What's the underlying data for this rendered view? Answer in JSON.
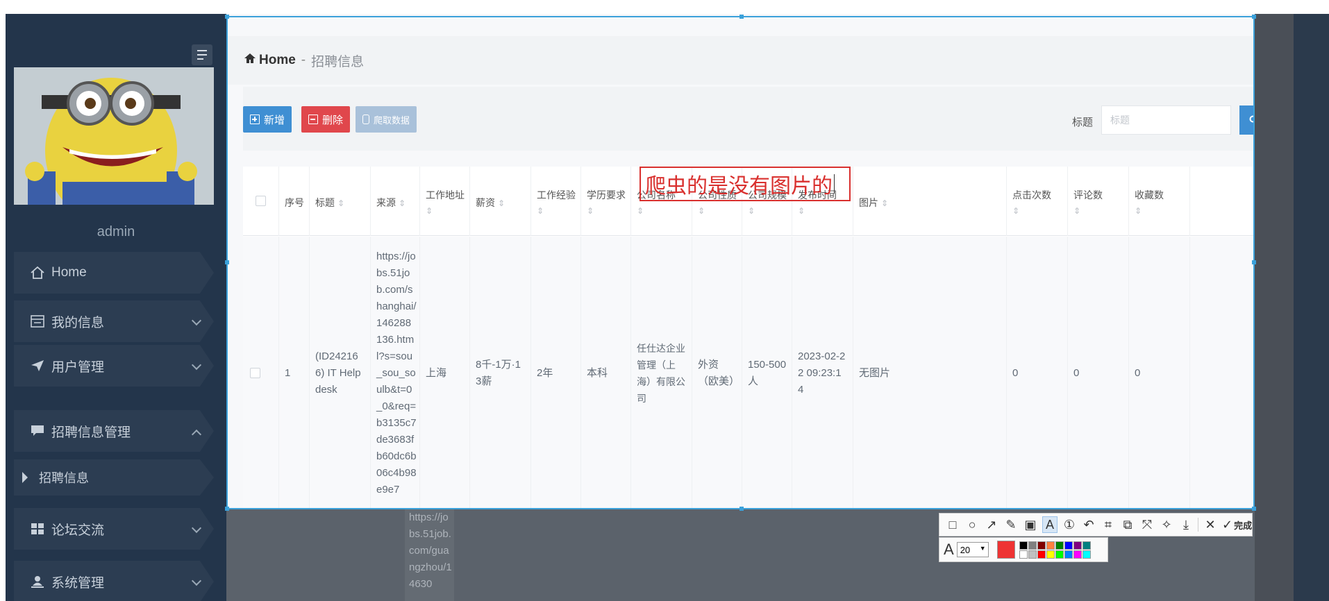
{
  "sidebar": {
    "username": "admin",
    "items": [
      {
        "label": "Home",
        "icon": "home-icon"
      },
      {
        "label": "我的信息",
        "icon": "profile-icon"
      },
      {
        "label": "用户管理",
        "icon": "send-icon"
      },
      {
        "label": "招聘信息管理",
        "icon": "chat-icon"
      },
      {
        "label": "招聘信息",
        "icon": "caret-right-icon"
      },
      {
        "label": "论坛交流",
        "icon": "grid-icon"
      },
      {
        "label": "系统管理",
        "icon": "user-icon"
      }
    ]
  },
  "breadcrumb": {
    "home": "Home",
    "separator": "-",
    "current": "招聘信息"
  },
  "toolbar": {
    "add_label": "新增",
    "delete_label": "删除",
    "crawl_label": "爬取数据",
    "search_label": "标题",
    "search_placeholder": "标题",
    "search_button": "查询"
  },
  "table": {
    "columns": [
      "序号",
      "标题",
      "来源",
      "工作地址",
      "薪资",
      "工作经验",
      "学历要求",
      "公司名称",
      "公司性质",
      "公司规模",
      "发布时间",
      "图片",
      "点击次数",
      "评论数",
      "收藏数"
    ],
    "row": {
      "index": "1",
      "title": "(ID242166) IT Helpdesk",
      "source": "https://jobs.51job.com/shanghai/146288136.html?s=sou_sou_soulb&t=0_0&req=b3135c7de3683fb60dc6b06c4b98e9e7",
      "address": "上海",
      "salary": "8千-1万·13薪",
      "experience": "2年",
      "education": "本科",
      "company": "任仕达企业管理（上海）有限公司",
      "nature": "外资（欧美）",
      "scale": "150-500人",
      "publish_time": "2023-02-22 09:23:14",
      "image": "无图片",
      "clicks": "0",
      "comments": "0",
      "favorites": "0"
    },
    "next_row_source_partial": "https://jobs.51job.com/guangzhou/14630"
  },
  "annotation": {
    "text": "爬虫的是没有图片的"
  },
  "capture_tool": {
    "done_label": "完成",
    "font_size": "20",
    "current_color": "#ee3333",
    "palette": [
      "#000000",
      "#808080",
      "#800000",
      "#ff8040",
      "#008000",
      "#0000ff",
      "#800080",
      "#008080",
      "#ffffff",
      "#c0c0c0",
      "#ff0000",
      "#ffff00",
      "#00ff00",
      "#0080ff",
      "#ff00ff",
      "#00ffff"
    ]
  }
}
